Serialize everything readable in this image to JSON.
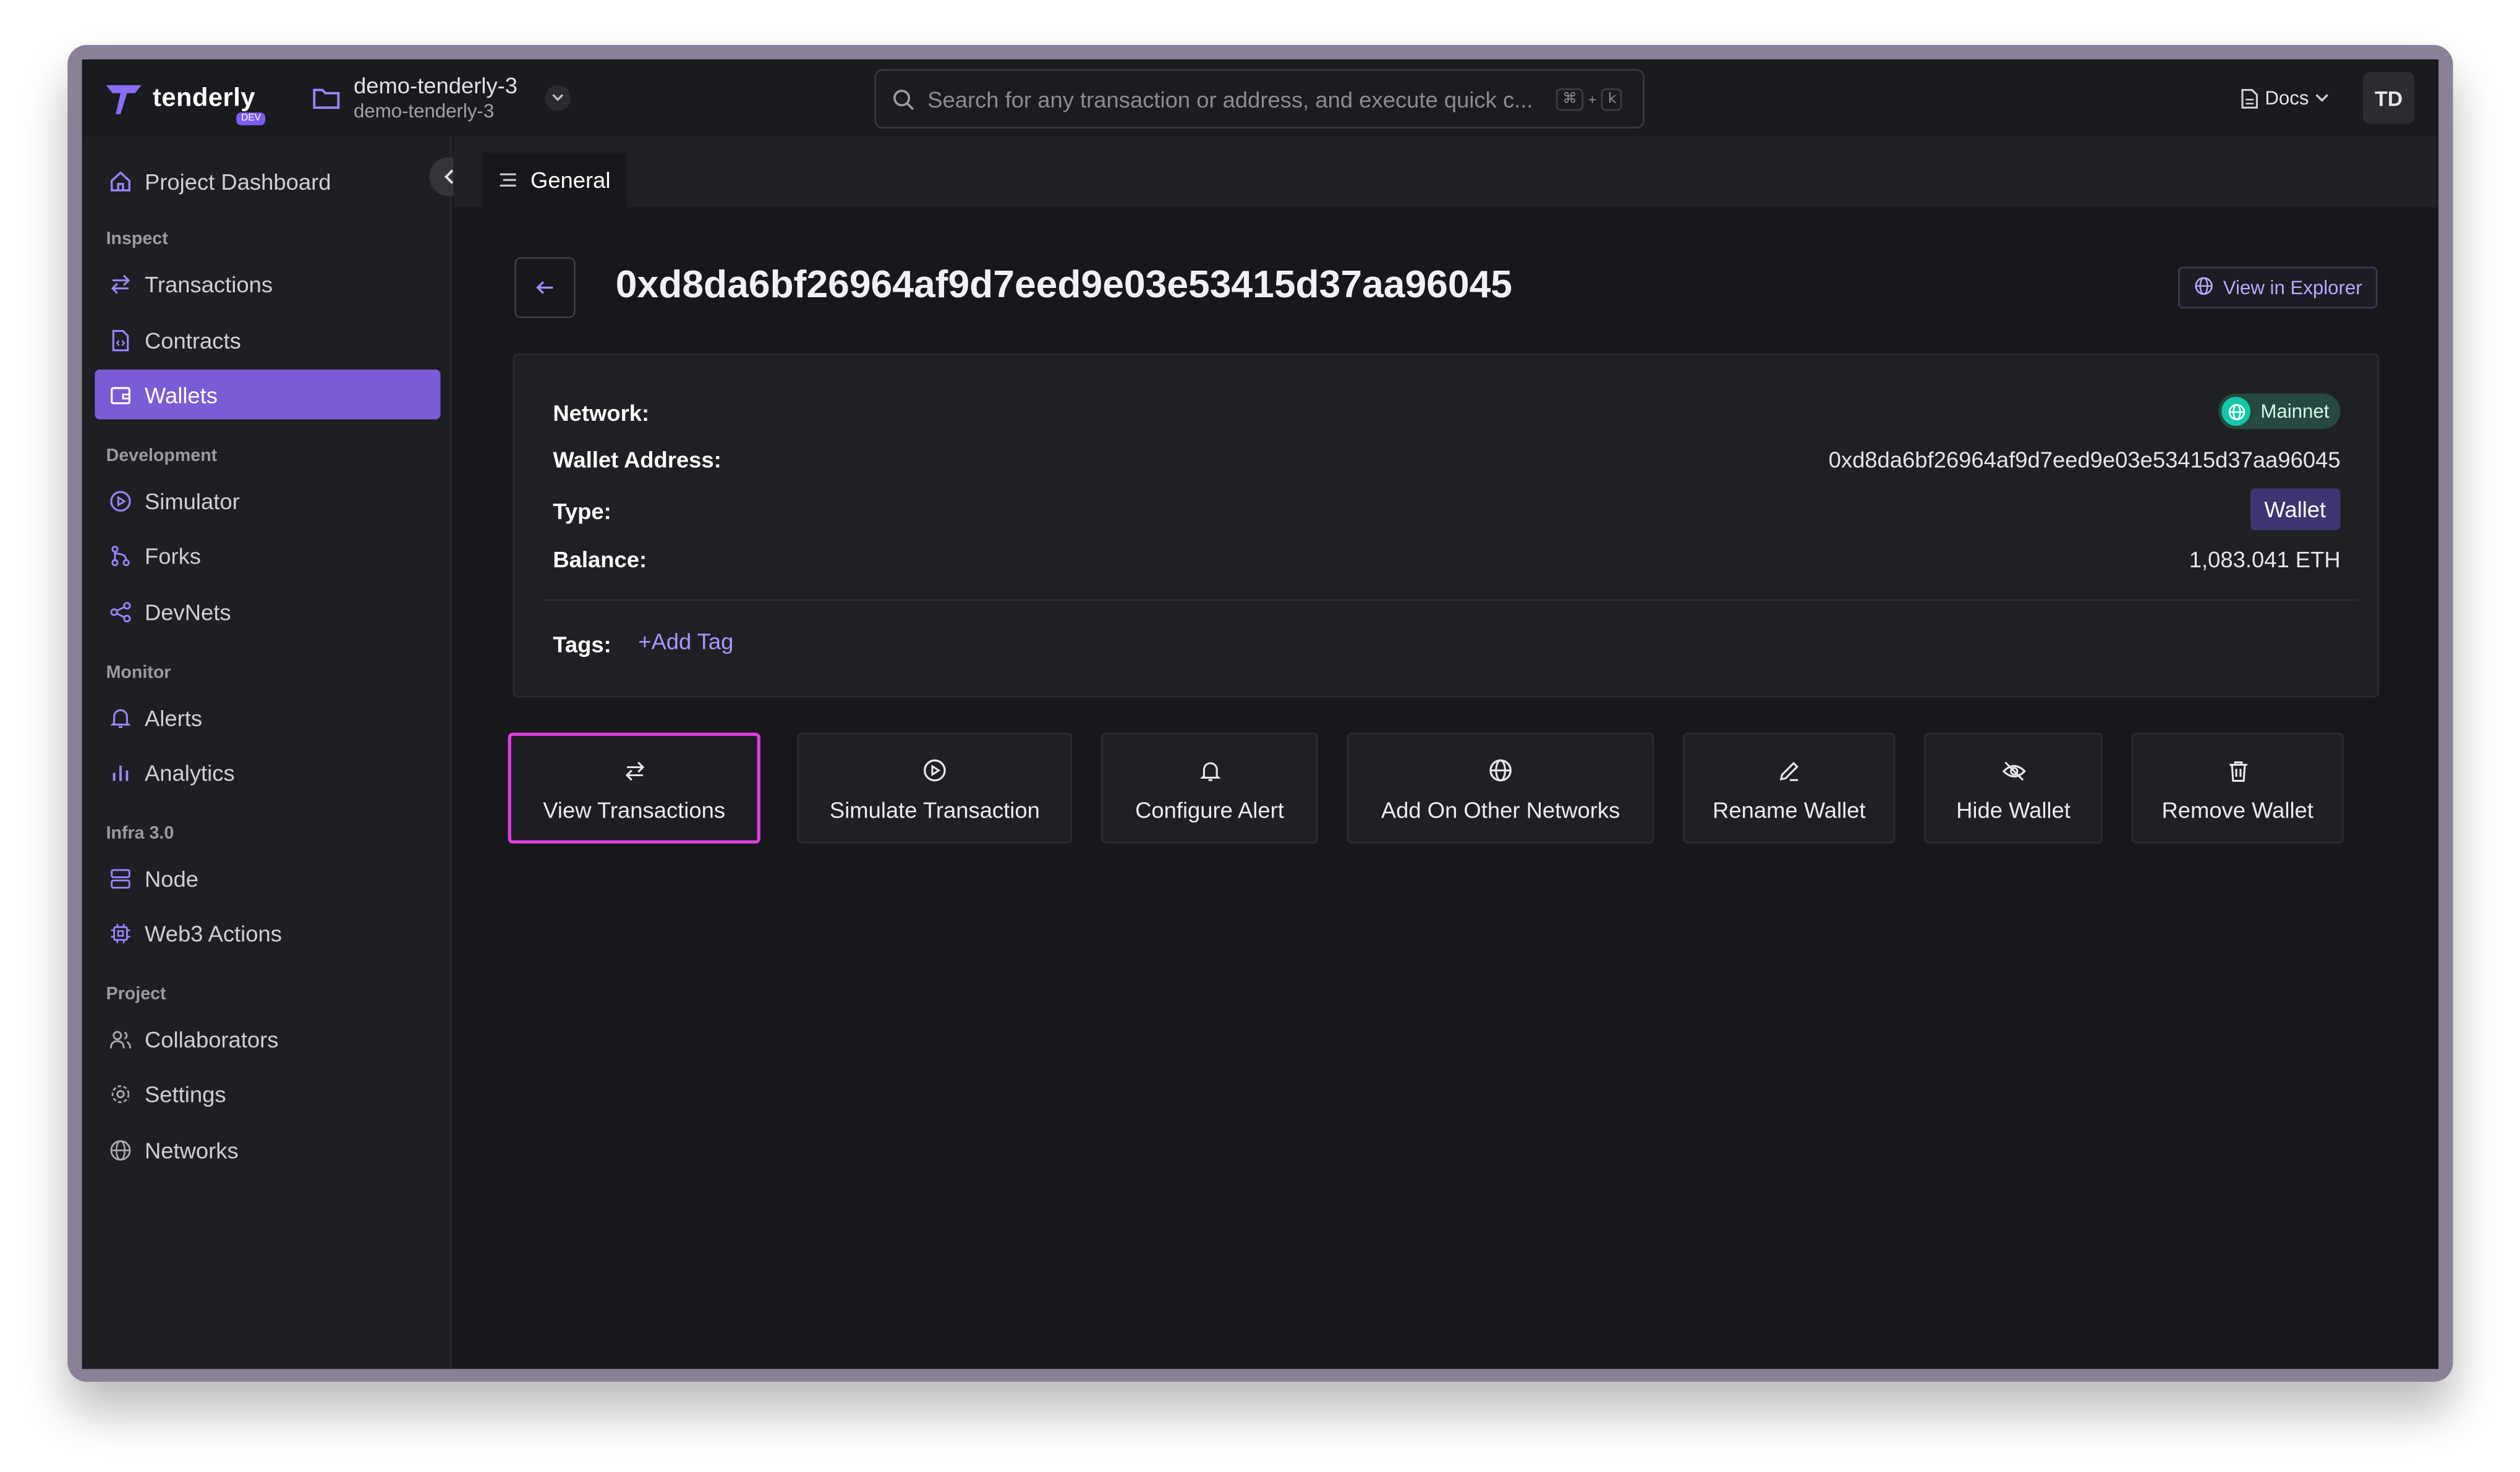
{
  "brand": {
    "name": "tenderly",
    "badge": "DEV"
  },
  "project": {
    "name": "demo-tenderly-3",
    "slug": "demo-tenderly-3"
  },
  "search": {
    "placeholder": "Search for any transaction or address, and execute quick c...",
    "kbd_cmd": "⌘",
    "kbd_plus": "+",
    "kbd_key": "k"
  },
  "topbar": {
    "docs_label": "Docs",
    "avatar_initials": "TD"
  },
  "sidebar": {
    "dashboard": "Project Dashboard",
    "groups": {
      "inspect": "Inspect",
      "development": "Development",
      "monitor": "Monitor",
      "infra": "Infra 3.0",
      "project": "Project"
    },
    "items": {
      "transactions": "Transactions",
      "contracts": "Contracts",
      "wallets": "Wallets",
      "simulator": "Simulator",
      "forks": "Forks",
      "devnets": "DevNets",
      "alerts": "Alerts",
      "analytics": "Analytics",
      "node": "Node",
      "web3_actions": "Web3 Actions",
      "collaborators": "Collaborators",
      "settings": "Settings",
      "networks": "Networks"
    },
    "active": "wallets"
  },
  "tabs": {
    "general": "General"
  },
  "page": {
    "title": "0xd8da6bf26964af9d7eed9e03e53415d37aa96045",
    "explorer_label": "View in Explorer"
  },
  "details": {
    "network_label": "Network:",
    "network_value": "Mainnet",
    "address_label": "Wallet Address:",
    "address_value": "0xd8da6bf26964af9d7eed9e03e53415d37aa96045",
    "type_label": "Type:",
    "type_value": "Wallet",
    "balance_label": "Balance:",
    "balance_value": "1,083.041 ETH",
    "tags_label": "Tags:",
    "add_tag_label": "+Add Tag"
  },
  "actions": {
    "view_transactions": "View Transactions",
    "simulate_transaction": "Simulate Transaction",
    "configure_alert": "Configure Alert",
    "add_on_other_networks": "Add On Other Networks",
    "rename_wallet": "Rename Wallet",
    "hide_wallet": "Hide Wallet",
    "remove_wallet": "Remove Wallet"
  },
  "colors": {
    "accent": "#7c5cd6",
    "highlight": "#e03ee0",
    "link": "#a896ff",
    "mainnet": "#13c8a8"
  }
}
